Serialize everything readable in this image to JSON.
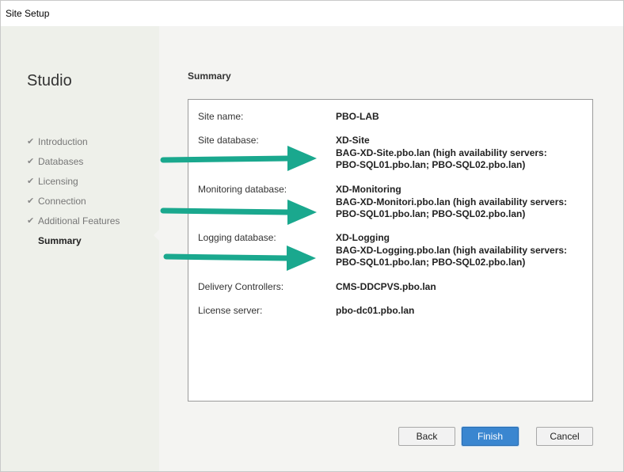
{
  "window": {
    "title": "Site Setup"
  },
  "nav": {
    "title": "Studio",
    "items": [
      {
        "label": "Introduction",
        "done": true
      },
      {
        "label": "Databases",
        "done": true
      },
      {
        "label": "Licensing",
        "done": true
      },
      {
        "label": "Connection",
        "done": true
      },
      {
        "label": "Additional Features",
        "done": true
      },
      {
        "label": "Summary",
        "done": false,
        "active": true
      }
    ]
  },
  "content": {
    "title": "Summary",
    "rows": [
      {
        "label": "Site name:",
        "lines": [
          "PBO-LAB"
        ]
      },
      {
        "label": "Site database:",
        "lines": [
          "XD-Site",
          "BAG-XD-Site.pbo.lan (high availability servers:",
          "PBO-SQL01.pbo.lan; PBO-SQL02.pbo.lan)"
        ]
      },
      {
        "label": "Monitoring database:",
        "lines": [
          "XD-Monitoring",
          "BAG-XD-Monitori.pbo.lan (high availability servers:",
          "PBO-SQL01.pbo.lan; PBO-SQL02.pbo.lan)"
        ]
      },
      {
        "label": "Logging database:",
        "lines": [
          "XD-Logging",
          "BAG-XD-Logging.pbo.lan (high availability servers:",
          "PBO-SQL01.pbo.lan; PBO-SQL02.pbo.lan)"
        ]
      },
      {
        "label": "Delivery Controllers:",
        "lines": [
          "CMS-DDCPVS.pbo.lan"
        ]
      },
      {
        "label": "License server:",
        "lines": [
          "pbo-dc01.pbo.lan"
        ]
      }
    ]
  },
  "buttons": {
    "back": "Back",
    "finish": "Finish",
    "cancel": "Cancel"
  },
  "colors": {
    "arrow": "#1aa88e",
    "primary_button": "#3a86d0"
  },
  "icons": {
    "check": "checkmark-icon",
    "arrow": "arrow-right-icon"
  }
}
